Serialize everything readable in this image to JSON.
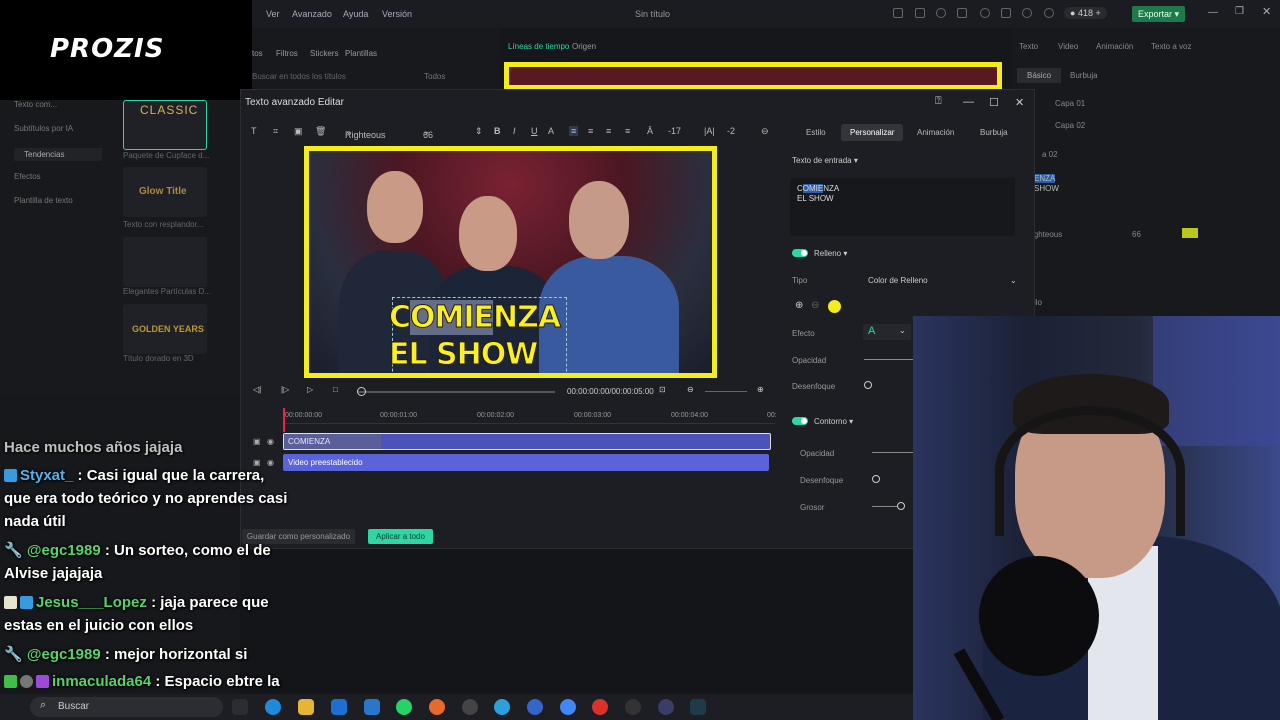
{
  "menu": {
    "items": [
      "Ver",
      "Avanzado",
      "Ayuda",
      "Versión"
    ],
    "window_title": "Sin título",
    "credits": "418",
    "export_label": "Exportar"
  },
  "logo": {
    "text": "PROZIS"
  },
  "left_panel": {
    "tools": [
      "Filtros",
      "Stickers",
      "Plantillas"
    ],
    "search_placeholder": "Buscar en todos los títulos",
    "filter": "Todos",
    "categories": [
      "Texto com...",
      "Subtítulos por IA",
      "Tendencias",
      "Efectos",
      "Plantilla de texto"
    ],
    "templates": [
      {
        "preview": "CLASSIC",
        "label": "Paquete de Cupface d..."
      },
      {
        "preview": "Glow Title",
        "label": "Texto con resplandor..."
      },
      {
        "preview": "",
        "label": "Elegantes Partículas D..."
      },
      {
        "preview": "GOLDEN YEARS",
        "label": "Título dorado en 3D"
      }
    ]
  },
  "timeline_top": {
    "tabs": [
      "Líneas de tiempo",
      "Origen"
    ]
  },
  "dialog": {
    "title": "Texto avanzado Editar",
    "font": "Righteous",
    "size": "66",
    "char_spacing": "-17",
    "line_spacing": "-2",
    "preview_text": {
      "line1": "COMIENZA",
      "line2": "EL SHOW",
      "highlight": "OMIE"
    },
    "timecode": "00:00:00:00/00:00:05:00",
    "ruler": [
      "00:00:00:00",
      "00:00:01:00",
      "00:00:02:00",
      "00:00:03:00",
      "00:00:04:00",
      "00:"
    ],
    "tracks": [
      {
        "label": "COMIENZA"
      },
      {
        "label": "Video preestablecido"
      }
    ],
    "save_custom": "Guardar como personalizado",
    "apply_all": "Aplicar a todo",
    "right_tabs": [
      "Estilo",
      "Personalizar",
      "Animación",
      "Burbuja"
    ],
    "input_label": "Texto de entrada",
    "input_text": {
      "pre": "C",
      "hl": "OMIE",
      "post": "NZA",
      "line2": "EL SHOW"
    },
    "fill_label": "Relleno",
    "type_label": "Tipo",
    "type_value": "Color de Relleno",
    "fill_color": "#f4ec1b",
    "effect_label": "Efecto",
    "effect_value": "A",
    "opacity_label": "Opacidad",
    "blur_label": "Desenfoque",
    "outline_label": "Contorno",
    "outline_opacity": "Opacidad",
    "outline_blur": "Desenfoque",
    "thickness_label": "Grosor"
  },
  "editor_right": {
    "tabs": [
      "Texto",
      "Video",
      "Animación",
      "Texto a voz"
    ],
    "subtabs": [
      "Básico",
      "Burbuja"
    ],
    "layers": [
      "Capa 01",
      "Capa 02"
    ],
    "layer_label": "a 02",
    "preview": {
      "hl": "OMIE",
      "pre": "C",
      "post": "NZA",
      "line2": "EL SHOW",
      "cut": "ENZA",
      "cut2": "SHOW"
    },
    "font": "ighteous",
    "size": "66",
    "style_label": "ilo"
  },
  "chat": [
    {
      "user": "",
      "text": "Hace muchos años jajaja"
    },
    {
      "user": "Styxat_",
      "text": ": Casi igual que la carrera, que era todo teórico y no aprendes casi nada útil"
    },
    {
      "user": "@egc1989",
      "text": ": Un sorteo, como el de Alvise jajajaja"
    },
    {
      "user": "Jesus___Lopez",
      "text": ": jaja parece que estas en el juicio con ellos"
    },
    {
      "user": "@egc1989",
      "text": ": mejor horizontal si"
    },
    {
      "user": "inmaculada64",
      "text": ": Espacio ebtre la a y e"
    }
  ],
  "taskbar": {
    "search": "Buscar"
  },
  "colors": {
    "accent": "#2ed6a6",
    "yellow": "#f4ec1b",
    "track": "#4b52b8"
  }
}
